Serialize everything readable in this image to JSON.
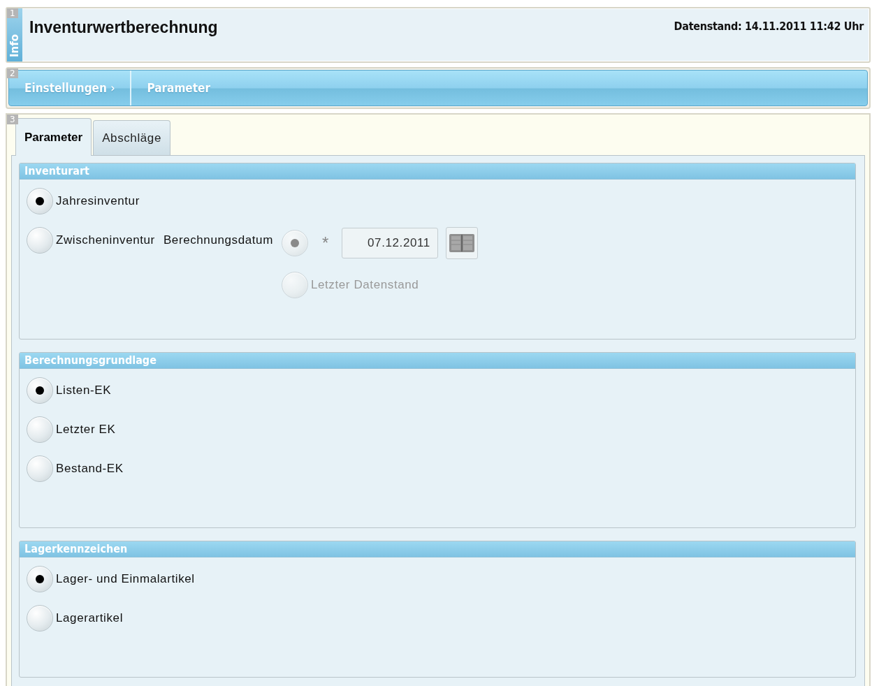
{
  "header": {
    "number": "1",
    "side_label": "Info",
    "title": "Inventurwertberechnung",
    "timestamp": "Datenstand: 14.11.2011 11:42 Uhr"
  },
  "breadcrumb": {
    "number": "2",
    "items": [
      {
        "label": "Einstellungen",
        "separator": "›"
      },
      {
        "label": "Parameter"
      }
    ]
  },
  "tabs": {
    "number": "3",
    "items": [
      {
        "label": "Parameter",
        "selected": true
      },
      {
        "label": "Abschläge",
        "selected": false
      }
    ]
  },
  "groups": [
    {
      "title": "Inventurart",
      "options": [
        {
          "label": "Jahresinventur",
          "selected": true,
          "disabled": false
        },
        {
          "label": "Zwischeninventur",
          "selected": false,
          "disabled": false,
          "sub_label": "Berechnungsdatum",
          "sub_options": [
            {
              "kind": "date",
              "selected": true,
              "disabled": true,
              "required": "*",
              "value": "07.12.2011"
            },
            {
              "kind": "plain",
              "label": "Letzter Datenstand",
              "selected": false,
              "disabled": true
            }
          ]
        }
      ]
    },
    {
      "title": "Berechnungsgrundlage",
      "options": [
        {
          "label": "Listen-EK",
          "selected": true,
          "disabled": false
        },
        {
          "label": "Letzter EK",
          "selected": false,
          "disabled": false
        },
        {
          "label": "Bestand-EK",
          "selected": false,
          "disabled": false
        }
      ]
    },
    {
      "title": "Lagerkennzeichen",
      "options": [
        {
          "label": "Lager- und Einmalartikel",
          "selected": true,
          "disabled": false
        },
        {
          "label": "Lagerartikel",
          "selected": false,
          "disabled": false
        }
      ]
    }
  ]
}
